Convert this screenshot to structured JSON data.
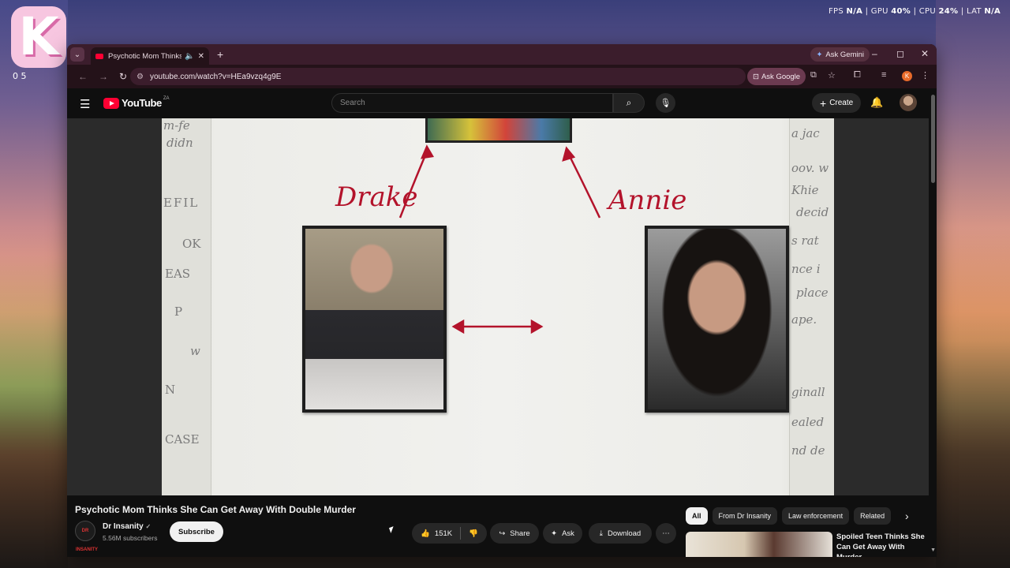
{
  "desktop": {
    "app_logo_letter": "K",
    "counter": "0 5",
    "perf": {
      "fps_label": "FPS",
      "fps_value": "N/A",
      "gpu_label": "GPU",
      "gpu_value": "40%",
      "cpu_label": "CPU",
      "cpu_value": "24%",
      "lat_label": "LAT",
      "lat_value": "N/A",
      "separator": "|"
    }
  },
  "browser": {
    "tab": {
      "title": "Psychotic Mom Thinks She Can Get Away With Double Murder",
      "audio_icon": "speaker-icon",
      "close_icon": "close-icon"
    },
    "new_tab": "+",
    "ask_gemini": "Ask Gemini",
    "window_controls": {
      "minimize": "–",
      "maximize": "◻",
      "close": "✕"
    },
    "url": "youtube.com/watch?v=HEa9vzq4g9E",
    "ask_google": "Ask Google",
    "profile_initial": "K"
  },
  "youtube": {
    "logo_text": "YouTube",
    "country_code": "ZA",
    "search_placeholder": "Search",
    "create_label": "Create"
  },
  "video": {
    "labels": {
      "left_person": "Drake",
      "right_person": "Annie"
    },
    "scribbles_left": [
      "m-fe",
      "didn",
      "EFIL",
      "OK",
      "EAS",
      "P",
      "w",
      "N",
      "CASE"
    ],
    "scribbles_right": [
      "a jac",
      "oov. w",
      "Khie",
      "decid",
      "s rat",
      "nce i",
      "place",
      "ape.",
      "ginall",
      "ealed",
      "nd de"
    ]
  },
  "watch": {
    "title": "Psychotic Mom Thinks She Can Get Away With Double Murder",
    "channel_name": "Dr Insanity",
    "channel_avatar_text": "DR INSANITY",
    "verified": "✓",
    "subscribers": "5.56M subscribers",
    "subscribe_label": "Subscribe",
    "likes": "151K",
    "share_label": "Share",
    "ask_label": "Ask",
    "download_label": "Download"
  },
  "sidebar": {
    "chips": [
      "All",
      "From Dr Insanity",
      "Law enforcement",
      "Related"
    ],
    "recommendation_title": "Spoiled Teen Thinks She Can Get Away With Murder"
  }
}
